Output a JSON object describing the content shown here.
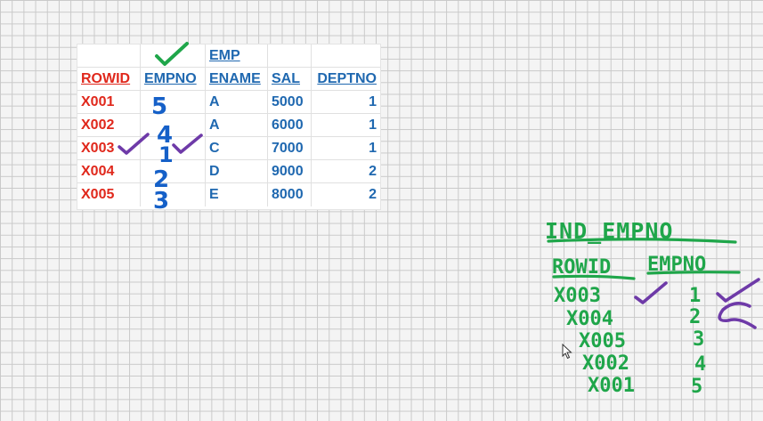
{
  "sheet": {
    "table_name": "EMP",
    "headers": [
      "ROWID",
      "EMPNO",
      "ENAME",
      "SAL",
      "DEPTNO"
    ],
    "rows": [
      {
        "rowid": "X001",
        "ename": "A",
        "sal": "5000",
        "deptno": "1"
      },
      {
        "rowid": "X002",
        "ename": "A",
        "sal": "6000",
        "deptno": "1"
      },
      {
        "rowid": "X003",
        "ename": "C",
        "sal": "7000",
        "deptno": "1"
      },
      {
        "rowid": "X004",
        "ename": "D",
        "sal": "9000",
        "deptno": "2"
      },
      {
        "rowid": "X005",
        "ename": "E",
        "sal": "8000",
        "deptno": "2"
      }
    ],
    "handwritten_empno": [
      "5",
      "4",
      "1",
      "2",
      "3"
    ]
  },
  "index_note": {
    "title": "IND_EMPNO",
    "headers": [
      "ROWID",
      "EMPNO"
    ],
    "rows": [
      {
        "rowid": "X003",
        "empno": "1"
      },
      {
        "rowid": "X004",
        "empno": "2"
      },
      {
        "rowid": "X005",
        "empno": "3"
      },
      {
        "rowid": "X002",
        "empno": "4"
      },
      {
        "rowid": "X001",
        "empno": "5"
      }
    ]
  },
  "colors": {
    "rowid_red": "#e0281c",
    "header_blue": "#1f68b0",
    "ink_green": "#1fa64a",
    "ink_blue": "#1560c8",
    "ink_purple": "#6e3aa8"
  },
  "icons": [
    "check-mark-icon",
    "mouse-pointer-icon"
  ]
}
